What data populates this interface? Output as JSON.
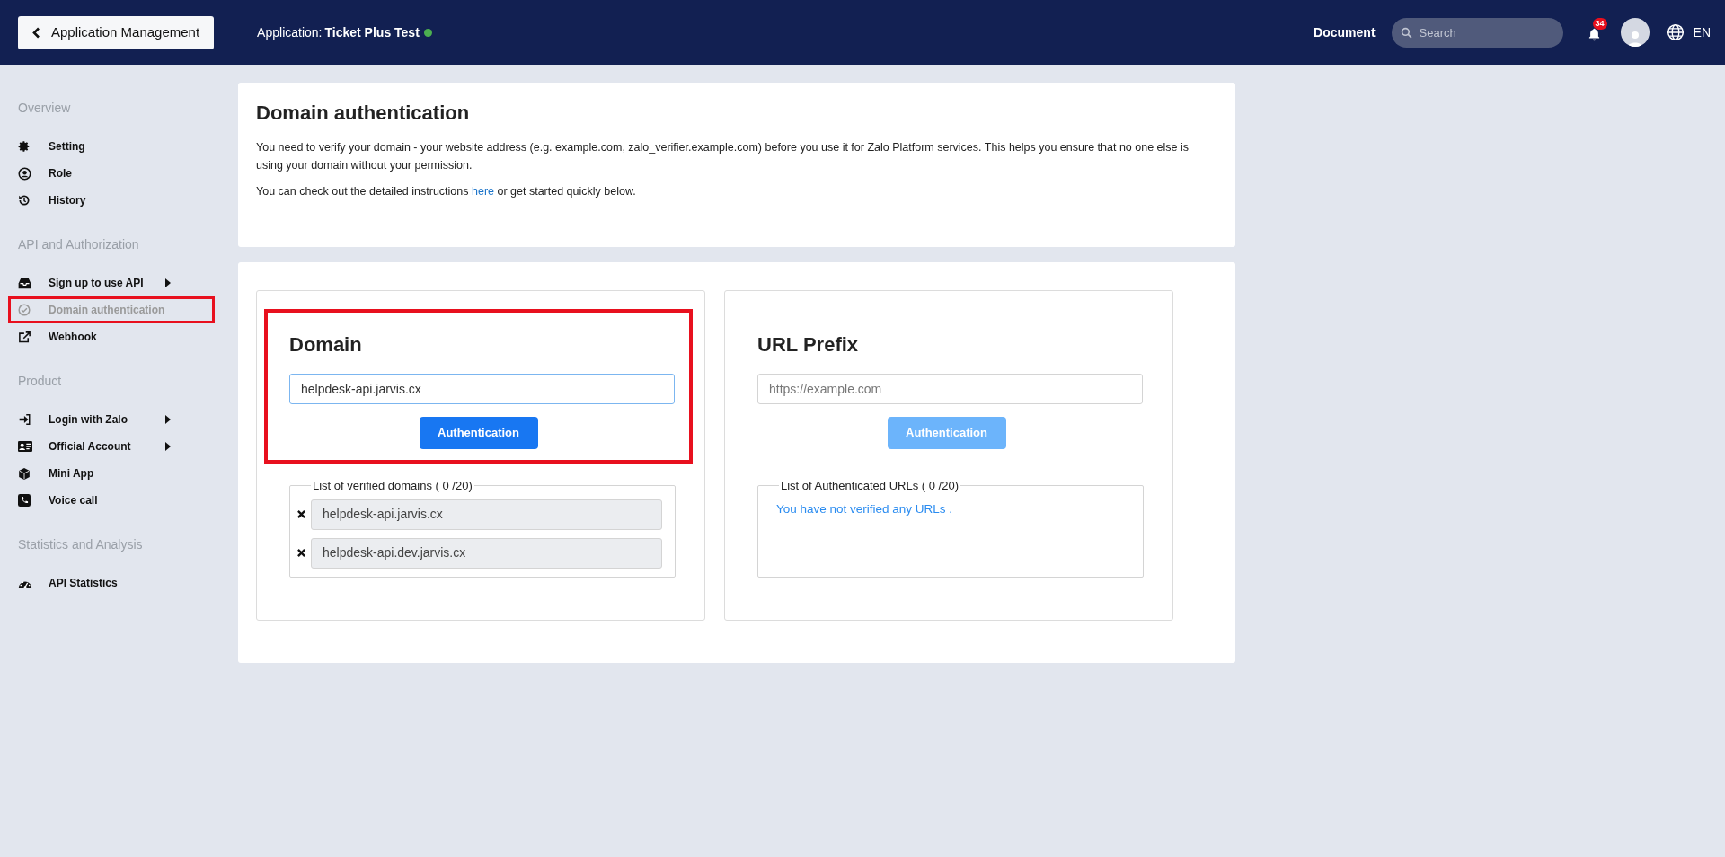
{
  "header": {
    "back_button": "Application Management",
    "app_label": "Application:",
    "app_name": "Ticket Plus Test",
    "app_online": true,
    "document_link": "Document",
    "search": {
      "placeholder": "Search"
    },
    "notifications_count": "34",
    "language": "EN"
  },
  "sidebar": {
    "sections": [
      {
        "title": "Overview",
        "items": [
          {
            "label": "Setting",
            "selected": false,
            "submenu": false
          },
          {
            "label": "Role",
            "selected": false,
            "submenu": false
          },
          {
            "label": "History",
            "selected": false,
            "submenu": false
          }
        ]
      },
      {
        "title": "API and Authorization",
        "items": [
          {
            "label": "Sign up to use API",
            "selected": false,
            "submenu": true
          },
          {
            "label": "Domain authentication",
            "selected": true,
            "submenu": false
          },
          {
            "label": "Webhook",
            "selected": false,
            "submenu": false
          }
        ]
      },
      {
        "title": "Product",
        "items": [
          {
            "label": "Login with Zalo",
            "selected": false,
            "submenu": true
          },
          {
            "label": "Official Account",
            "selected": false,
            "submenu": true
          },
          {
            "label": "Mini App",
            "selected": false,
            "submenu": false
          },
          {
            "label": "Voice call",
            "selected": false,
            "submenu": false
          }
        ]
      },
      {
        "title": "Statistics and Analysis",
        "items": [
          {
            "label": "API Statistics",
            "selected": false,
            "submenu": false
          }
        ]
      }
    ]
  },
  "intro": {
    "title": "Domain authentication",
    "description": "You need to verify your domain - your website address (e.g. example.com, zalo_verifier.example.com) before you use it for Zalo Platform services. This helps you ensure that no one else is using your domain without your permission.",
    "instructions_before": "You can check out the detailed instructions",
    "instructions_link": "here",
    "instructions_after": "or get started quickly below."
  },
  "panels": [
    {
      "title": "Domain",
      "highlighted": true,
      "input": {
        "value": "helpdesk-api.jarvis.cx"
      },
      "button": {
        "label": "Authentication",
        "disabled": false
      },
      "list_title": "List of verified domains ( 0 /20)",
      "items": [
        "helpdesk-api.jarvis.cx",
        "helpdesk-api.dev.jarvis.cx"
      ]
    },
    {
      "title": "URL Prefix",
      "highlighted": false,
      "input": {
        "placeholder": "https://example.com"
      },
      "button": {
        "label": "Authentication",
        "disabled": true
      },
      "list_title": "List of Authenticated URLs ( 0 /20)",
      "empty_message": "You have not verified any URLs ."
    }
  ]
}
